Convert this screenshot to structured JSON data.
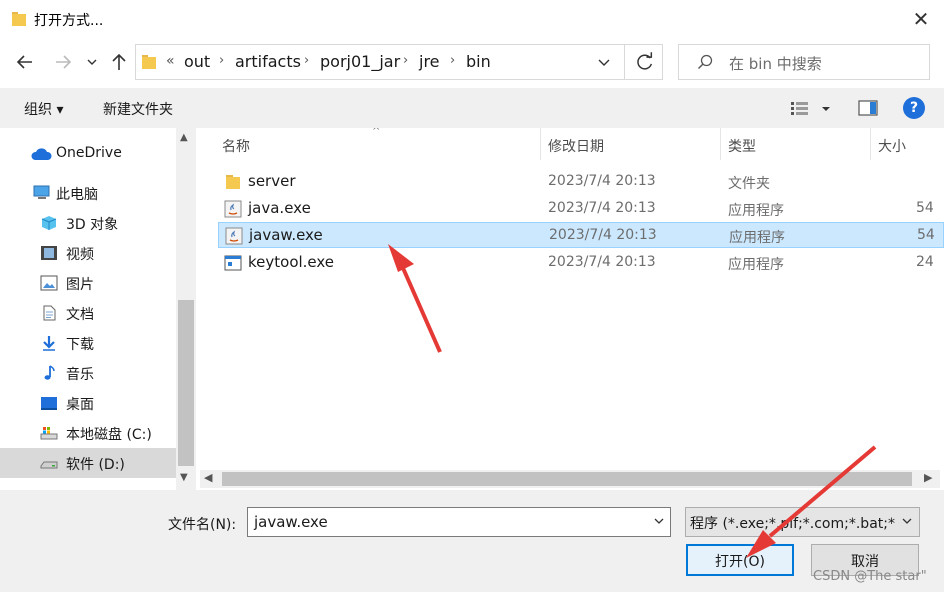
{
  "window": {
    "title": "打开方式...",
    "close_glyph": "✕"
  },
  "address": {
    "overflow_glyph": "«",
    "crumbs": [
      "out",
      "artifacts",
      "porj01_jar",
      "jre",
      "bin"
    ]
  },
  "search": {
    "placeholder": "在 bin 中搜索"
  },
  "toolbar": {
    "organize_label": "组织 ▾",
    "new_folder_label": "新建文件夹",
    "help_glyph": "?"
  },
  "sidebar": {
    "items": [
      {
        "label": "OneDrive",
        "icon": "cloud-icon"
      },
      {
        "label": "此电脑",
        "icon": "computer-icon"
      },
      {
        "label": "3D 对象",
        "icon": "cube-icon"
      },
      {
        "label": "视频",
        "icon": "video-icon"
      },
      {
        "label": "图片",
        "icon": "picture-icon"
      },
      {
        "label": "文档",
        "icon": "document-icon"
      },
      {
        "label": "下载",
        "icon": "download-icon"
      },
      {
        "label": "音乐",
        "icon": "music-icon"
      },
      {
        "label": "桌面",
        "icon": "desktop-icon"
      },
      {
        "label": "本地磁盘 (C:)",
        "icon": "drive-c-icon"
      },
      {
        "label": "软件 (D:)",
        "icon": "drive-d-icon",
        "selected": true
      }
    ]
  },
  "file_list": {
    "columns": [
      "名称",
      "修改日期",
      "类型",
      "大小"
    ],
    "rows": [
      {
        "name": "server",
        "date": "2023/7/4 20:13",
        "type": "文件夹",
        "size": "",
        "icon": "folder-icon"
      },
      {
        "name": "java.exe",
        "date": "2023/7/4 20:13",
        "type": "应用程序",
        "size": "54",
        "icon": "java-exe-icon"
      },
      {
        "name": "javaw.exe",
        "date": "2023/7/4 20:13",
        "type": "应用程序",
        "size": "54",
        "icon": "java-exe-icon",
        "selected": true
      },
      {
        "name": "keytool.exe",
        "date": "2023/7/4 20:13",
        "type": "应用程序",
        "size": "24",
        "icon": "window-exe-icon"
      }
    ]
  },
  "bottom": {
    "filename_label": "文件名(N):",
    "filename_value": "javaw.exe",
    "filter_value": "程序 (*.exe;*.pif;*.com;*.bat;*",
    "open_label": "打开(O)",
    "cancel_label": "取消"
  },
  "watermark": "CSDN @The star\"",
  "colors": {
    "selection": "#cce8ff",
    "selection_border": "#99d1ff",
    "accent": "#0078d7",
    "annotation_arrow": "#e53935"
  }
}
